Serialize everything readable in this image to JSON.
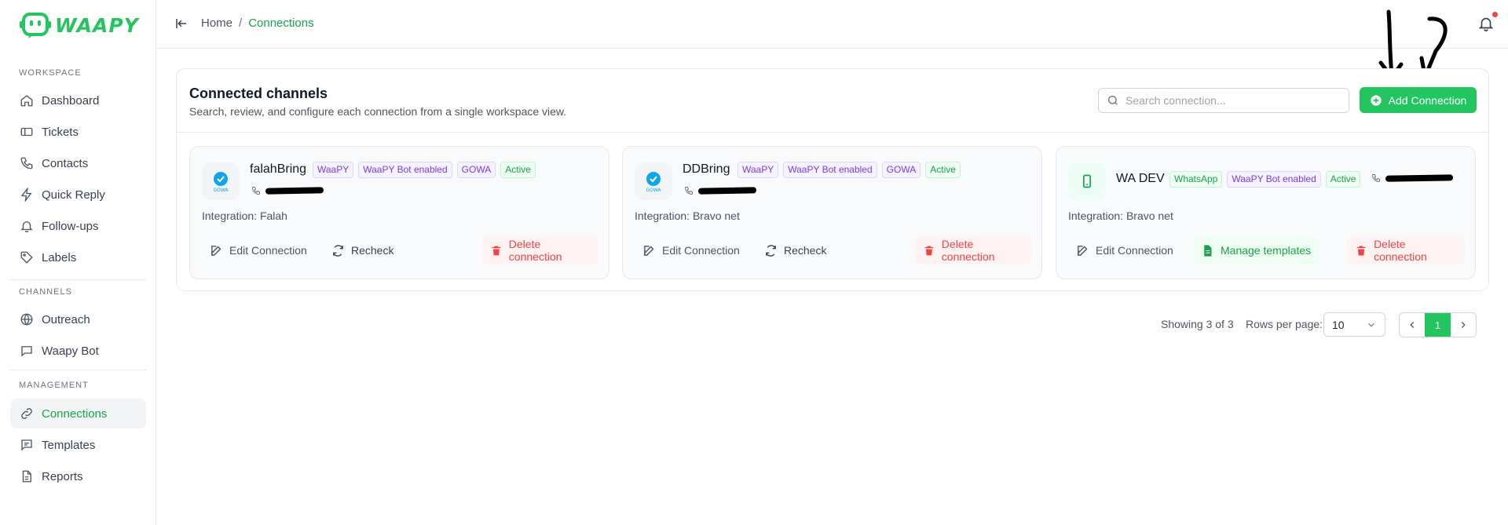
{
  "app": {
    "logo_text": "WAAPY",
    "brand_color": "#22c55e"
  },
  "sidebar": {
    "sections": [
      {
        "label": "Workspace",
        "items": [
          {
            "label": "Dashboard",
            "icon": "home-icon"
          },
          {
            "label": "Tickets",
            "icon": "ticket-icon"
          },
          {
            "label": "Contacts",
            "icon": "phone-icon"
          },
          {
            "label": "Quick Reply",
            "icon": "lightning-icon"
          },
          {
            "label": "Follow-ups",
            "icon": "bell-icon"
          },
          {
            "label": "Labels",
            "icon": "tag-icon"
          }
        ]
      },
      {
        "label": "Channels",
        "items": [
          {
            "label": "Outreach",
            "icon": "globe-icon"
          },
          {
            "label": "Waapy Bot",
            "icon": "chat-icon"
          }
        ]
      },
      {
        "label": "Management",
        "items": [
          {
            "label": "Connections",
            "icon": "link-icon",
            "active": true
          },
          {
            "label": "Templates",
            "icon": "message-icon"
          },
          {
            "label": "Reports",
            "icon": "document-icon"
          }
        ]
      }
    ]
  },
  "header": {
    "breadcrumb_home": "Home",
    "breadcrumb_sep": "/",
    "breadcrumb_current": "Connections"
  },
  "panel": {
    "title": "Connected channels",
    "subtitle": "Search, review, and configure each connection from a single workspace view.",
    "search_placeholder": "Search connection...",
    "add_button": "Add Connection"
  },
  "connections": [
    {
      "name": "falahBring",
      "avatar": "GOWA",
      "badges": [
        "WaaPY",
        "WaaPY Bot enabled",
        "GOWA",
        "Active"
      ],
      "integration": "Integration: Falah",
      "actions": [
        "Edit Connection",
        "Recheck",
        "Delete connection"
      ]
    },
    {
      "name": "DDBring",
      "avatar": "GOWA",
      "badges": [
        "WaaPY",
        "WaaPY Bot enabled",
        "GOWA",
        "Active"
      ],
      "integration": "Integration: Bravo net",
      "actions": [
        "Edit Connection",
        "Recheck",
        "Delete connection"
      ]
    },
    {
      "name": "WA DEV",
      "avatar": "mobile-icon",
      "badges": [
        "WhatsApp",
        "WaaPY Bot enabled",
        "Active"
      ],
      "integration": "Integration: Bravo net",
      "actions": [
        "Edit Connection",
        "Manage templates",
        "Delete connection"
      ]
    }
  ],
  "pagination": {
    "showing": "Showing 3 of 3",
    "rows_label": "Rows per page:",
    "rows_value": "10",
    "current_page": "1"
  }
}
